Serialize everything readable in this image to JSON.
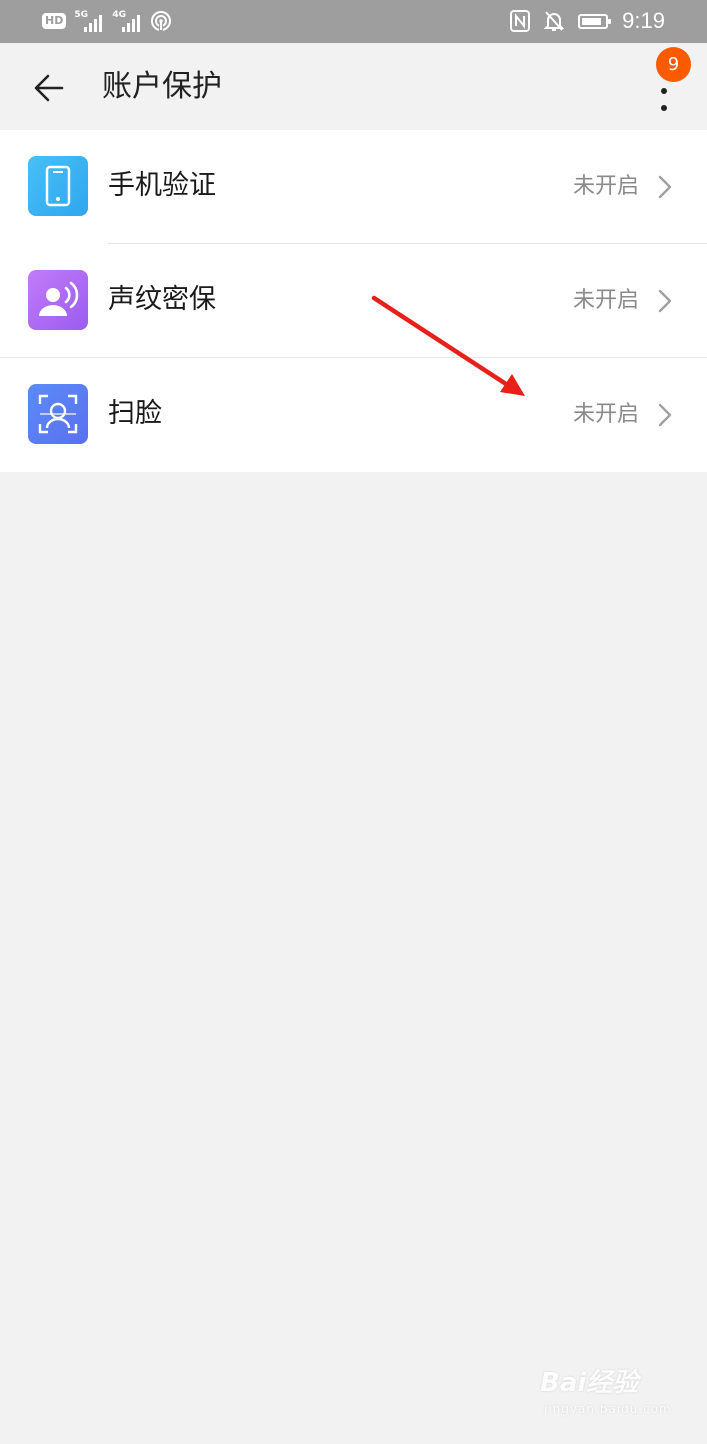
{
  "status_bar": {
    "hd_label": "HD",
    "signal1_label": "5G",
    "signal2_label": "4G",
    "time": "9:19",
    "battery_level": 0.85,
    "icons": [
      "hd-icon",
      "signal-5g-icon",
      "signal-4g-icon",
      "hotspot-icon",
      "nfc-icon",
      "bell-off-icon",
      "battery-charging-icon"
    ]
  },
  "app_bar": {
    "title": "账户保护",
    "back_icon": "arrow-left-icon",
    "more_icon": "more-vertical-icon",
    "badge_count": "9"
  },
  "items": [
    {
      "label": "手机验证",
      "status": "未开启",
      "icon": "phone-icon",
      "colors": [
        "#47c0f5",
        "#2fa6ef"
      ]
    },
    {
      "label": "声纹密保",
      "status": "未开启",
      "icon": "voiceprint-icon",
      "colors": [
        "#c27bf7",
        "#9a5cf1"
      ]
    },
    {
      "label": "扫脸",
      "status": "未开启",
      "icon": "face-scan-icon",
      "colors": [
        "#5b8cf7",
        "#5a70f0"
      ]
    }
  ],
  "annotation": {
    "color": "#e8201a"
  },
  "watermark": {
    "main": "Bai经验",
    "sub": "jingyan.baidu.com"
  },
  "colors": {
    "background": "#f2f2f2",
    "status_bar": "#9e9e9e",
    "badge": "#fa5a00"
  }
}
